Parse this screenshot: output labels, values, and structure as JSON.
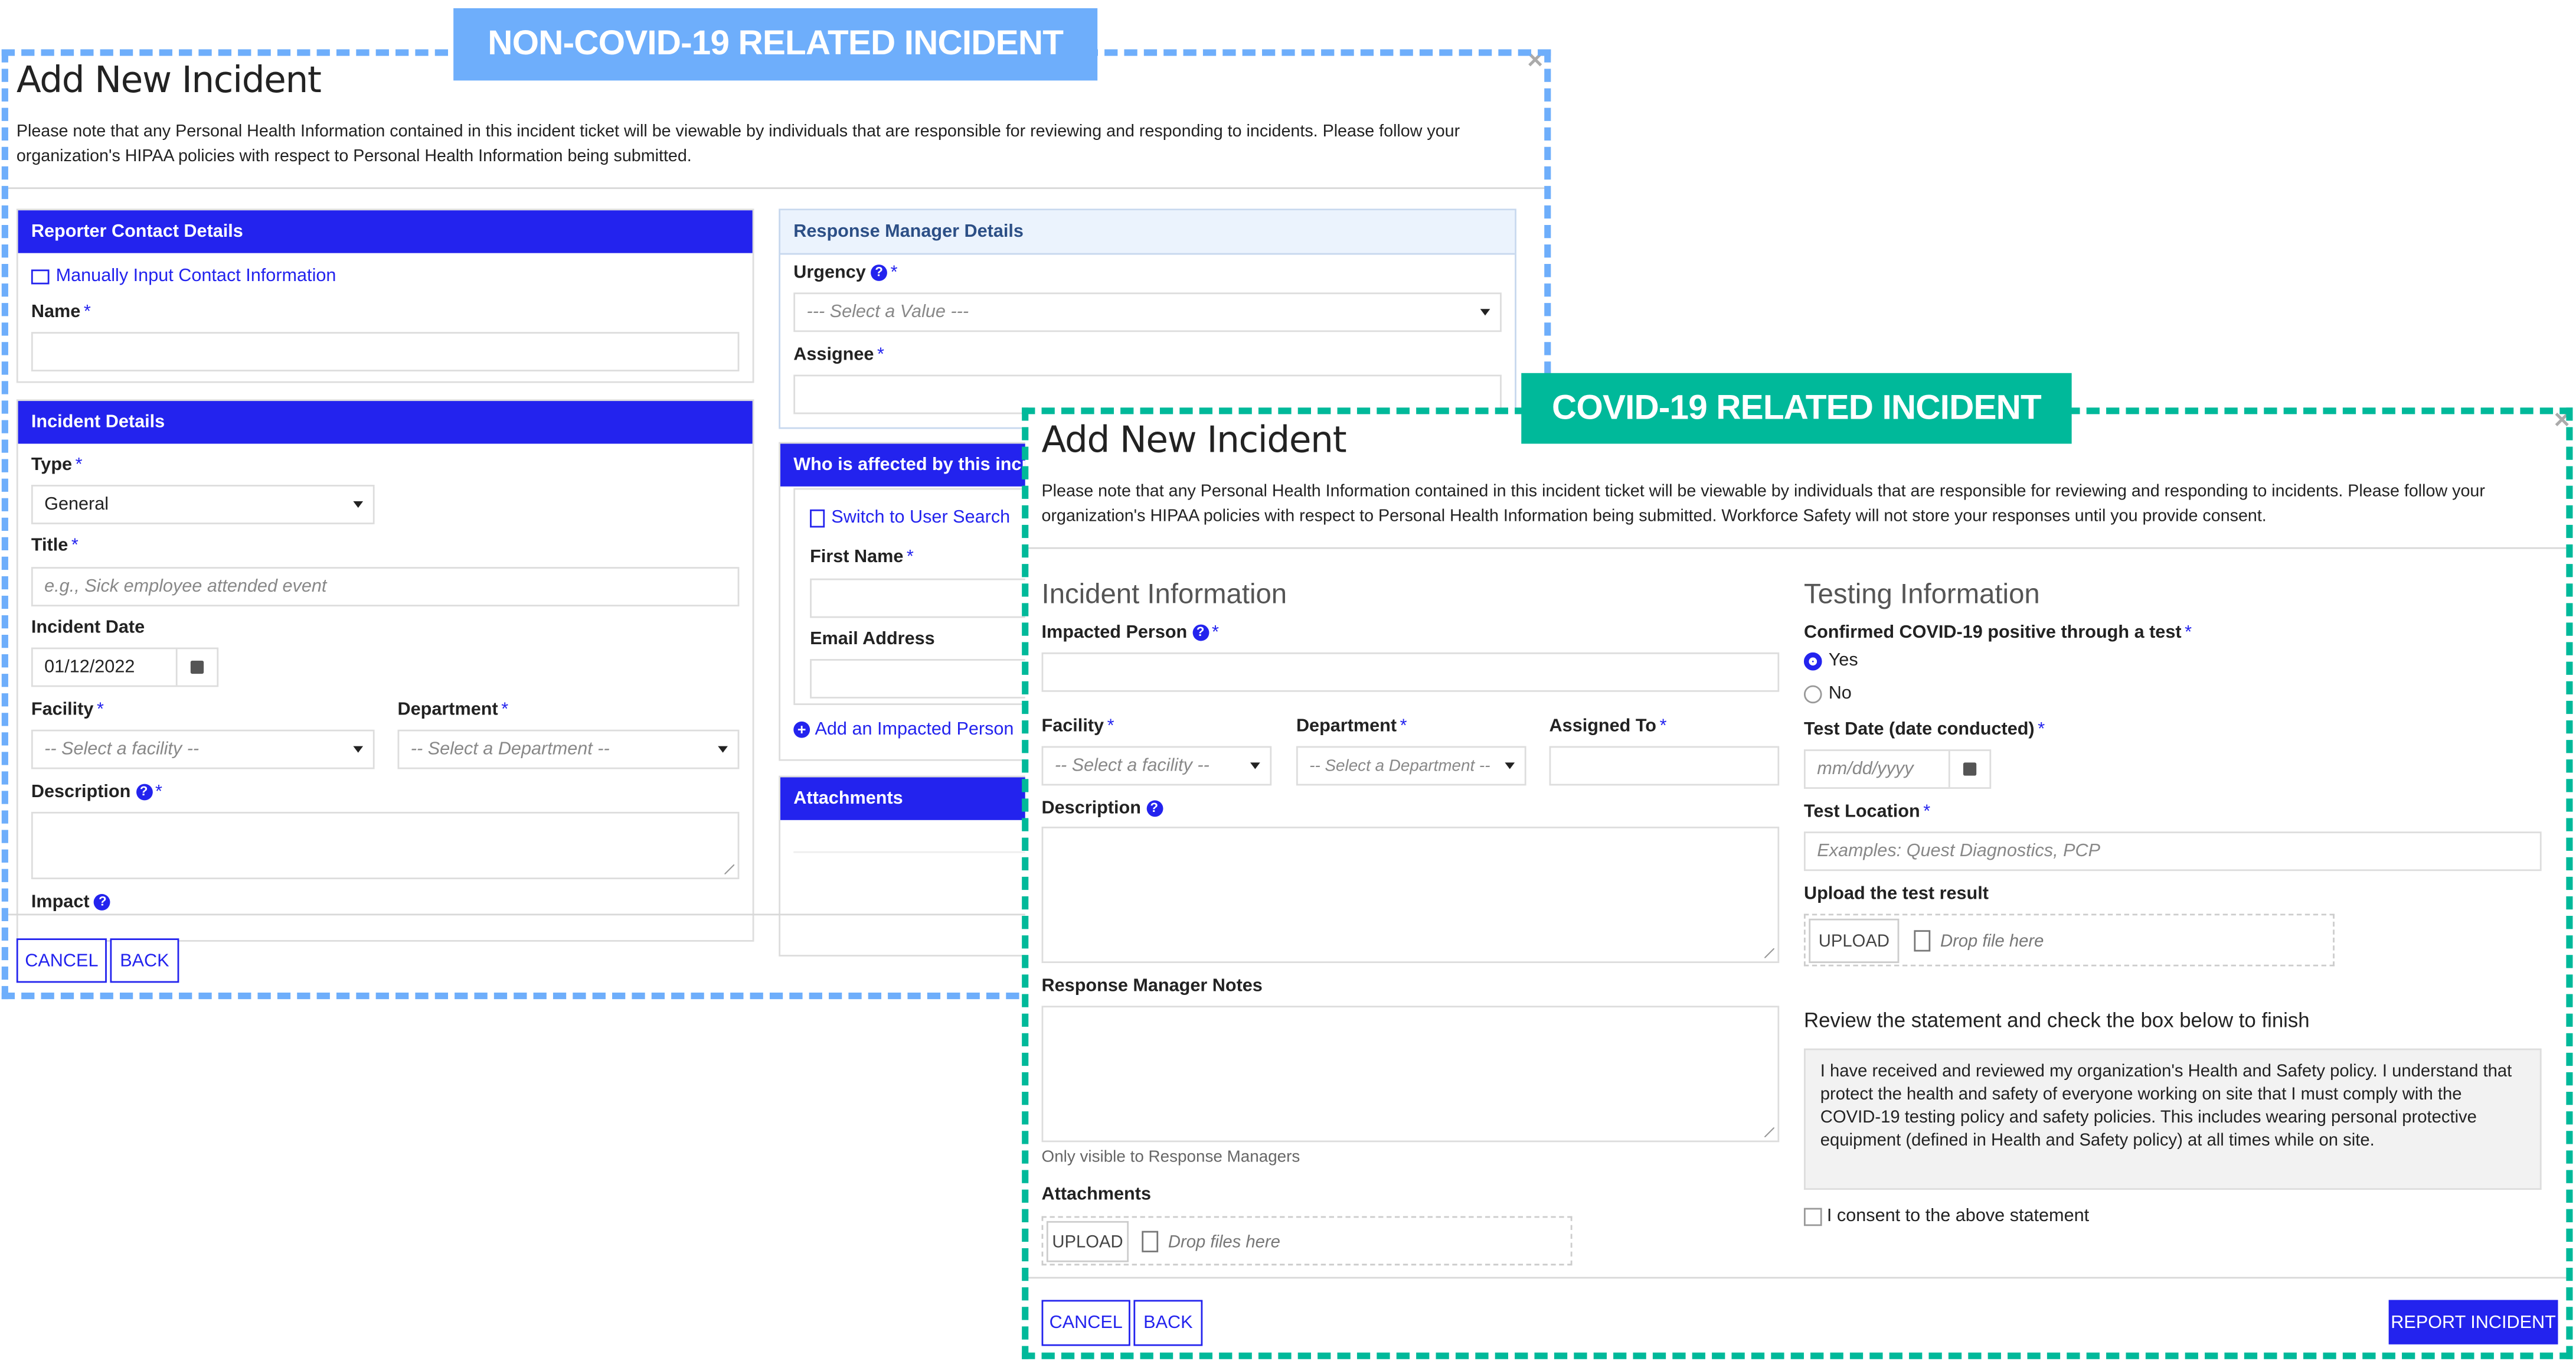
{
  "colors": {
    "non_covid_accent": "#6eaefb",
    "covid_accent": "#00b99a",
    "primary": "#2323ee",
    "panel_header_light": "#ebf3fd"
  },
  "non_covid": {
    "tag": "NON-COVID-19 RELATED INCIDENT",
    "title": "Add New Incident",
    "close_icon": "close-icon",
    "intro": "Please note that any Personal Health Information contained in this incident ticket will be viewable by individuals that are responsible for reviewing and responding to incidents. Please follow your organization's HIPAA policies with respect to Personal Health Information being submitted.",
    "reporter": {
      "header": "Reporter Contact Details",
      "manual_link": "Manually Input Contact Information",
      "name_label": "Name",
      "name_value": ""
    },
    "incident_details": {
      "header": "Incident Details",
      "type_label": "Type",
      "type_value": "General",
      "title_label": "Title",
      "title_placeholder": "e.g., Sick employee attended event",
      "date_label": "Incident Date",
      "date_value": "01/12/2022",
      "facility_label": "Facility",
      "facility_placeholder": "-- Select a facility --",
      "department_label": "Department",
      "department_placeholder": "-- Select a Department --",
      "description_label": "Description",
      "impact_label": "Impact"
    },
    "response_manager": {
      "header": "Response Manager Details",
      "urgency_label": "Urgency",
      "urgency_placeholder": "--- Select a Value ---",
      "assignee_label": "Assignee"
    },
    "affected": {
      "header": "Who is affected by this incident",
      "switch_link": "Switch to User Search",
      "first_name_label": "First Name",
      "email_label": "Email Address",
      "add_link": "Add an Impacted Person"
    },
    "attachments": {
      "header": "Attachments"
    },
    "footer": {
      "cancel": "CANCEL",
      "back": "BACK"
    }
  },
  "covid": {
    "tag": "COVID-19 RELATED INCIDENT",
    "title": "Add New Incident",
    "close_icon": "close-icon",
    "intro": "Please note that any Personal Health Information contained in this incident ticket will be viewable by individuals that are responsible for reviewing and responding to incidents. Please follow your organization's HIPAA policies with respect to Personal Health Information being submitted. Workforce Safety will not store your responses until you provide consent.",
    "incident_info": {
      "heading": "Incident Information",
      "impacted_label": "Impacted Person",
      "facility_label": "Facility",
      "facility_placeholder": "-- Select a facility --",
      "department_label": "Department",
      "department_placeholder": "-- Select a Department --",
      "assigned_label": "Assigned To",
      "description_label": "Description",
      "notes_label": "Response Manager Notes",
      "notes_hint": "Only visible to Response Managers",
      "attachments_label": "Attachments",
      "upload_button": "UPLOAD",
      "drop_text": "Drop files here"
    },
    "testing_info": {
      "heading": "Testing Information",
      "confirmed_label": "Confirmed COVID-19 positive through a test",
      "options": [
        {
          "label": "Yes",
          "selected": true
        },
        {
          "label": "No",
          "selected": false
        }
      ],
      "test_date_label": "Test Date (date conducted)",
      "test_date_placeholder": "mm/dd/yyyy",
      "location_label": "Test Location",
      "location_placeholder": "Examples: Quest Diagnostics, PCP",
      "upload_label": "Upload the test result",
      "upload_button": "UPLOAD",
      "drop_text": "Drop file here",
      "review_heading": "Review the statement and check the box below to finish",
      "statement": "I have received and reviewed my organization's Health and Safety policy. I understand that protect the health and safety of everyone working on site that I must comply with the COVID-19 testing policy and safety policies. This includes wearing personal protective equipment (defined in Health and Safety policy) at all times while on site.",
      "consent_label": "I consent to the above statement",
      "consent_checked": false
    },
    "footer": {
      "cancel": "CANCEL",
      "back": "BACK",
      "report": "REPORT INCIDENT"
    }
  }
}
